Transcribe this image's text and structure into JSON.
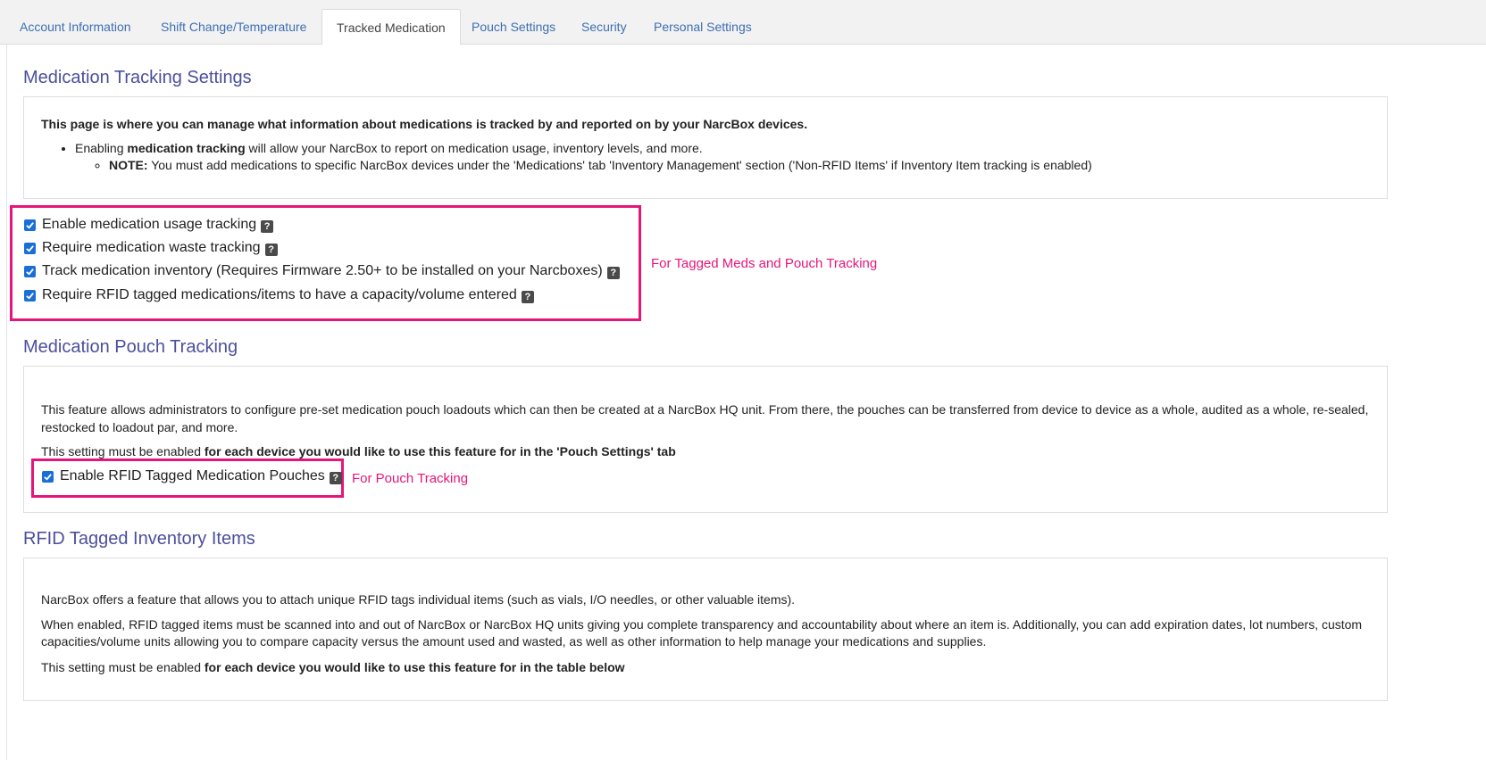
{
  "tabs": [
    {
      "label": "Account Information"
    },
    {
      "label": "Shift Change/Temperature"
    },
    {
      "label": "Tracked Medication"
    },
    {
      "label": "Pouch Settings"
    },
    {
      "label": "Security"
    },
    {
      "label": "Personal Settings"
    }
  ],
  "active_tab": "Tracked Medication",
  "med_tracking": {
    "title": "Medication Tracking Settings",
    "intro": "This page is where you can manage what information about medications is tracked by and reported on by your NarcBox devices.",
    "bullet_prefix": "Enabling ",
    "bullet_bold": "medication tracking",
    "bullet_suffix": " will allow your NarcBox to report on medication usage, inventory levels, and more.",
    "note_label": "NOTE:",
    "note_text": " You must add medications to specific NarcBox devices under the 'Medications' tab 'Inventory Management' section ('Non-RFID Items' if Inventory Item tracking is enabled)",
    "options": [
      {
        "label": "Enable medication usage tracking",
        "checked": true
      },
      {
        "label": "Require medication waste tracking",
        "checked": true
      },
      {
        "label": "Track medication inventory (Requires Firmware 2.50+ to be installed on your Narcboxes)",
        "checked": true
      },
      {
        "label": "Require RFID tagged medications/items to have a capacity/volume entered",
        "checked": true
      }
    ],
    "annotation": "For Tagged Meds and Pouch Tracking"
  },
  "pouch_tracking": {
    "title": "Medication Pouch Tracking",
    "description": "This feature allows administrators to configure pre-set medication pouch loadouts which can then be created at a NarcBox HQ unit. From there, the pouches can be transferred from device to device as a whole, audited as a whole, re-sealed, restocked to loadout par, and more.",
    "setting_prefix": "This setting must be enabled ",
    "setting_bold": "for each device you would like to use this feature for in the 'Pouch Settings' tab",
    "option": {
      "label": "Enable RFID Tagged Medication Pouches",
      "checked": true
    },
    "annotation": "For Pouch Tracking"
  },
  "rfid_items": {
    "title": "RFID Tagged Inventory Items",
    "para1": "NarcBox offers a feature that allows you to attach unique RFID tags individual items (such as vials, I/O needles, or other valuable items).",
    "para2": "When enabled, RFID tagged items must be scanned into and out of NarcBox or NarcBox HQ units giving you complete transparency and accountability about where an item is. Additionally, you can add expiration dates, lot numbers, custom capacities/volume units allowing you to compare capacity versus the amount used and wasted, as well as other information to help manage your medications and supplies.",
    "setting_prefix": "This setting must be enabled ",
    "setting_bold": "for each device you would like to use this feature for in the table below"
  },
  "help_glyph": "?",
  "colors": {
    "accent_pink": "#e6157a",
    "title_purple": "#4b4f9c",
    "tab_link": "#3d6fb2",
    "checkbox": "#1a6ed8"
  }
}
